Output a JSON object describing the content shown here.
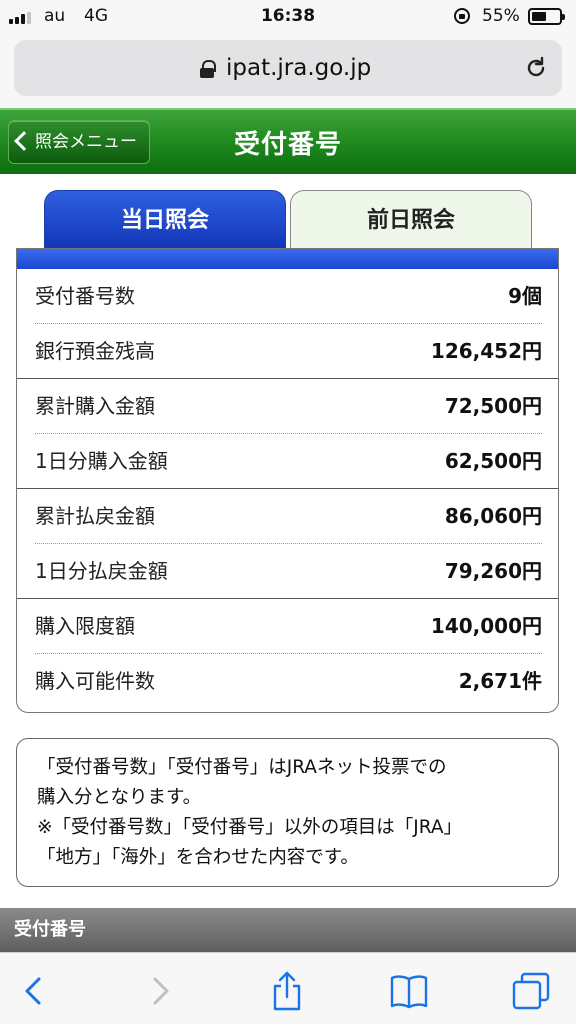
{
  "status_bar": {
    "carrier": "au",
    "network": "4G",
    "time": "16:38",
    "battery_percent": "55%",
    "battery_level": 0.55,
    "icons": [
      "signal-icon",
      "orientation-lock-icon",
      "battery-icon"
    ]
  },
  "browser": {
    "url": "ipat.jra.go.jp",
    "icons": [
      "lock-icon",
      "reload-icon"
    ]
  },
  "header": {
    "back_label": "照会メニュー",
    "title": "受付番号",
    "background_color": "#1f8a1e"
  },
  "tabs": [
    {
      "label": "当日照会",
      "active": true
    },
    {
      "label": "前日照会",
      "active": false
    }
  ],
  "accent_color": "#1a48cf",
  "rows": [
    {
      "label": "受付番号数",
      "value": "9個"
    },
    {
      "label": "銀行預金残高",
      "value": "126,452円"
    },
    {
      "label": "累計購入金額",
      "value": "72,500円"
    },
    {
      "label": "1日分購入金額",
      "value": "62,500円"
    },
    {
      "label": "累計払戻金額",
      "value": "86,060円"
    },
    {
      "label": "1日分払戻金額",
      "value": "79,260円"
    },
    {
      "label": "購入限度額",
      "value": "140,000円"
    },
    {
      "label": "購入可能件数",
      "value": "2,671件"
    }
  ],
  "notice": {
    "lines": [
      "「受付番号数」「受付番号」はJRAネット投票での",
      "購入分となります。",
      "※「受付番号数」「受付番号」以外の項目は「JRA」",
      "「地方」「海外」を合わせた内容です。"
    ]
  },
  "section": {
    "title": "受付番号"
  },
  "toolbar": {
    "icons": [
      "back-icon",
      "forward-icon",
      "share-icon",
      "bookmarks-icon",
      "tabs-icon"
    ]
  }
}
